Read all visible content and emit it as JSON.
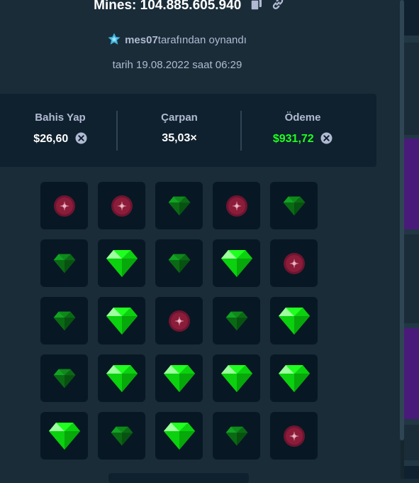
{
  "header": {
    "title": "Mines: 104.885.605.940",
    "copy_icon": "copy-icon",
    "link_icon": "link-icon"
  },
  "player": {
    "name": "mes07",
    "suffix": "tarafından oynandı",
    "icon": "star-badge-icon"
  },
  "date": "tarih 19.08.2022 saat 06:29",
  "stats": {
    "bet": {
      "label": "Bahis Yap",
      "value": "$26,60"
    },
    "multiplier": {
      "label": "Çarpan",
      "value": "35,03×"
    },
    "payout": {
      "label": "Ödeme",
      "value": "$931,72"
    }
  },
  "colors": {
    "background": "#1a2c38",
    "panel": "#0f212e",
    "tile": "#071824",
    "gem_bright": "#1fff20",
    "gem_dim": "#0e7a17",
    "mine": "#8b1c3a",
    "payout_text": "#1fff20",
    "side_accent": "#4a1a7a"
  },
  "board": {
    "legend": {
      "G": "revealed gem",
      "g": "unrevealed gem (dim)",
      "m": "mine (dim)"
    },
    "rows": [
      [
        "m",
        "m",
        "g",
        "m",
        "g"
      ],
      [
        "g",
        "G",
        "g",
        "G",
        "m"
      ],
      [
        "g",
        "G",
        "m",
        "g",
        "G"
      ],
      [
        "g",
        "G",
        "G",
        "G",
        "G"
      ],
      [
        "G",
        "g",
        "G",
        "g",
        "m"
      ]
    ]
  }
}
